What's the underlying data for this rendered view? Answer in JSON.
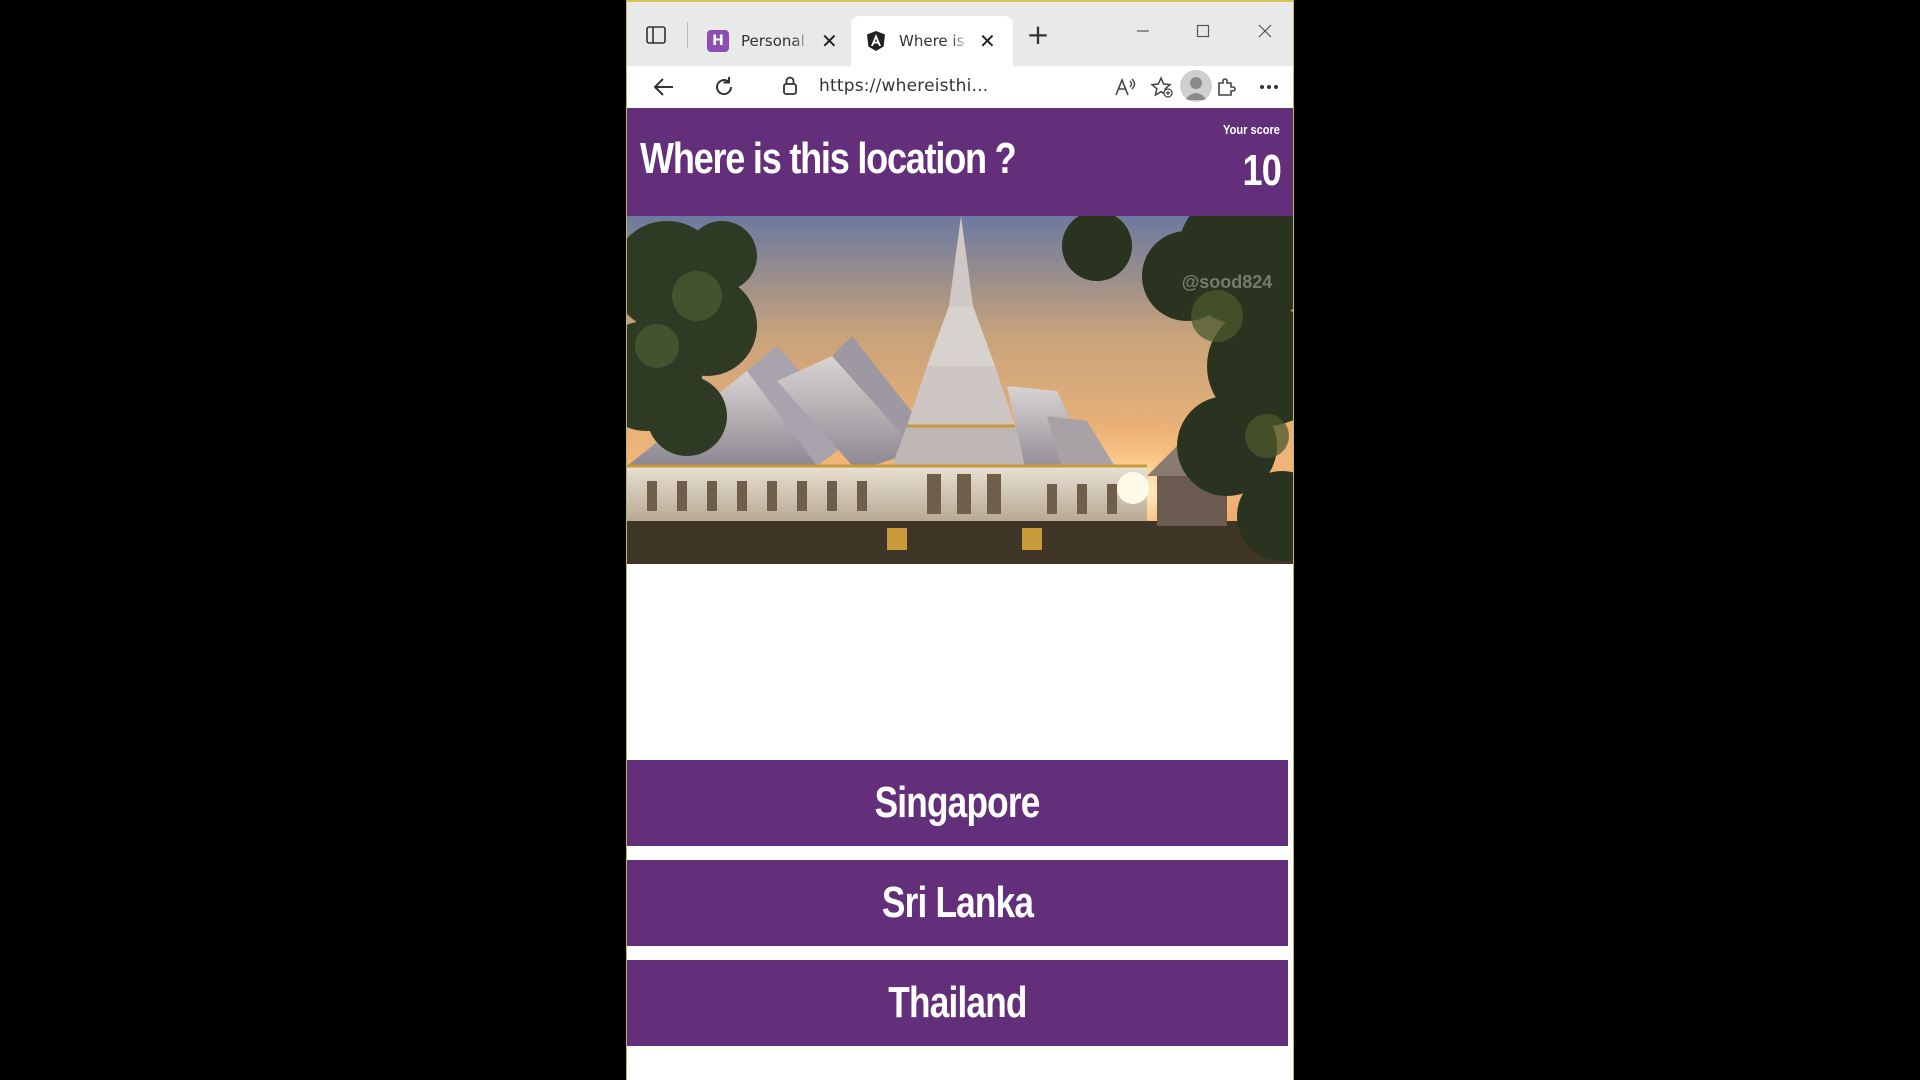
{
  "browser": {
    "tabs": [
      {
        "title": "Personal a",
        "favicon": "h-logo-icon"
      },
      {
        "title": "Where is t",
        "favicon": "angular-icon",
        "active": true
      }
    ],
    "url": "https://whereisthi..."
  },
  "app": {
    "title": "Where is this location ?",
    "score_label": "Your score",
    "score_value": "10",
    "photo_watermark": "@sood824",
    "answers": [
      "Singapore",
      "Sri Lanka",
      "Thailand"
    ],
    "accent_color": "#632f7a"
  }
}
